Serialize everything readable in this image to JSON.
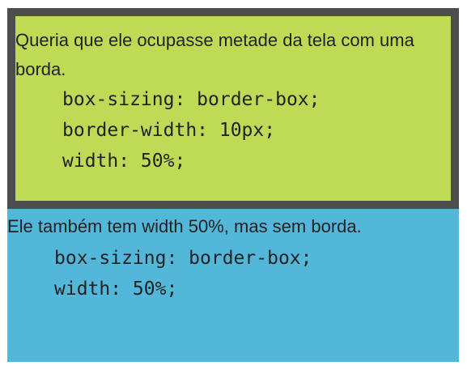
{
  "bordered_box": {
    "text": "Queria que ele ocupasse metade da tela com uma borda.",
    "code_lines": [
      "box-sizing: border-box;",
      "border-width: 10px;",
      "width: 50%;"
    ]
  },
  "plain_box": {
    "text": "Ele também tem width 50%, mas sem borda.",
    "code_lines": [
      "box-sizing: border-box;",
      "width: 50%;"
    ]
  },
  "colors": {
    "border": "#4d4d4d",
    "green_fill": "#bfdb56",
    "blue_fill": "#52b7d9",
    "text": "#222222"
  }
}
